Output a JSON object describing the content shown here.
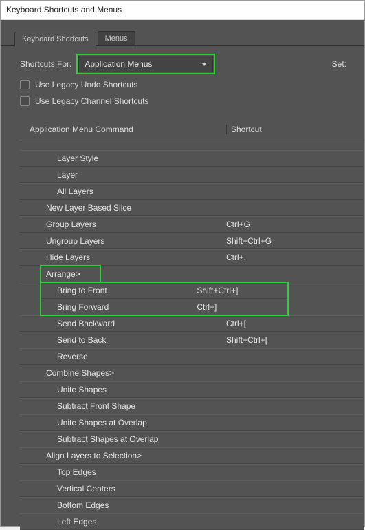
{
  "window": {
    "title": "Keyboard Shortcuts and Menus"
  },
  "tabs": {
    "shortcuts": "Keyboard Shortcuts",
    "menus": "Menus"
  },
  "controls": {
    "shortcutsForLabel": "Shortcuts For:",
    "shortcutsForValue": "Application Menus",
    "setLabel": "Set:",
    "legacyUndo": "Use Legacy Undo Shortcuts",
    "legacyChannel": "Use Legacy Channel Shortcuts"
  },
  "headers": {
    "command": "Application Menu Command",
    "shortcut": "Shortcut"
  },
  "rows": [
    {
      "label": "Layer Style",
      "shortcut": "",
      "indent": 2
    },
    {
      "label": "Layer",
      "shortcut": "",
      "indent": 2
    },
    {
      "label": "All Layers",
      "shortcut": "",
      "indent": 2
    },
    {
      "label": "New Layer Based Slice",
      "shortcut": "",
      "indent": 1
    },
    {
      "label": "Group Layers",
      "shortcut": "Ctrl+G",
      "indent": 1
    },
    {
      "label": "Ungroup Layers",
      "shortcut": "Shift+Ctrl+G",
      "indent": 1
    },
    {
      "label": "Hide Layers",
      "shortcut": "Ctrl+,",
      "indent": 1
    },
    {
      "label": "Arrange>",
      "shortcut": "",
      "indent": 1,
      "hlRow": true
    },
    {
      "label": "Bring to Front",
      "shortcut": "Shift+Ctrl+]",
      "indent": 2,
      "groupStart": true
    },
    {
      "label": "Bring Forward",
      "shortcut": "Ctrl+]",
      "indent": 2,
      "groupEnd": true
    },
    {
      "label": "Send Backward",
      "shortcut": "Ctrl+[",
      "indent": 2
    },
    {
      "label": "Send to Back",
      "shortcut": "Shift+Ctrl+[",
      "indent": 2
    },
    {
      "label": "Reverse",
      "shortcut": "",
      "indent": 2
    },
    {
      "label": "Combine Shapes>",
      "shortcut": "",
      "indent": 1
    },
    {
      "label": "Unite Shapes",
      "shortcut": "",
      "indent": 2
    },
    {
      "label": "Subtract Front Shape",
      "shortcut": "",
      "indent": 2
    },
    {
      "label": "Unite Shapes at Overlap",
      "shortcut": "",
      "indent": 2
    },
    {
      "label": "Subtract Shapes at Overlap",
      "shortcut": "",
      "indent": 2
    },
    {
      "label": "Align Layers to Selection>",
      "shortcut": "",
      "indent": 1
    },
    {
      "label": "Top Edges",
      "shortcut": "",
      "indent": 2
    },
    {
      "label": "Vertical Centers",
      "shortcut": "",
      "indent": 2
    },
    {
      "label": "Bottom Edges",
      "shortcut": "",
      "indent": 2
    },
    {
      "label": "Left Edges",
      "shortcut": "",
      "indent": 2
    }
  ]
}
